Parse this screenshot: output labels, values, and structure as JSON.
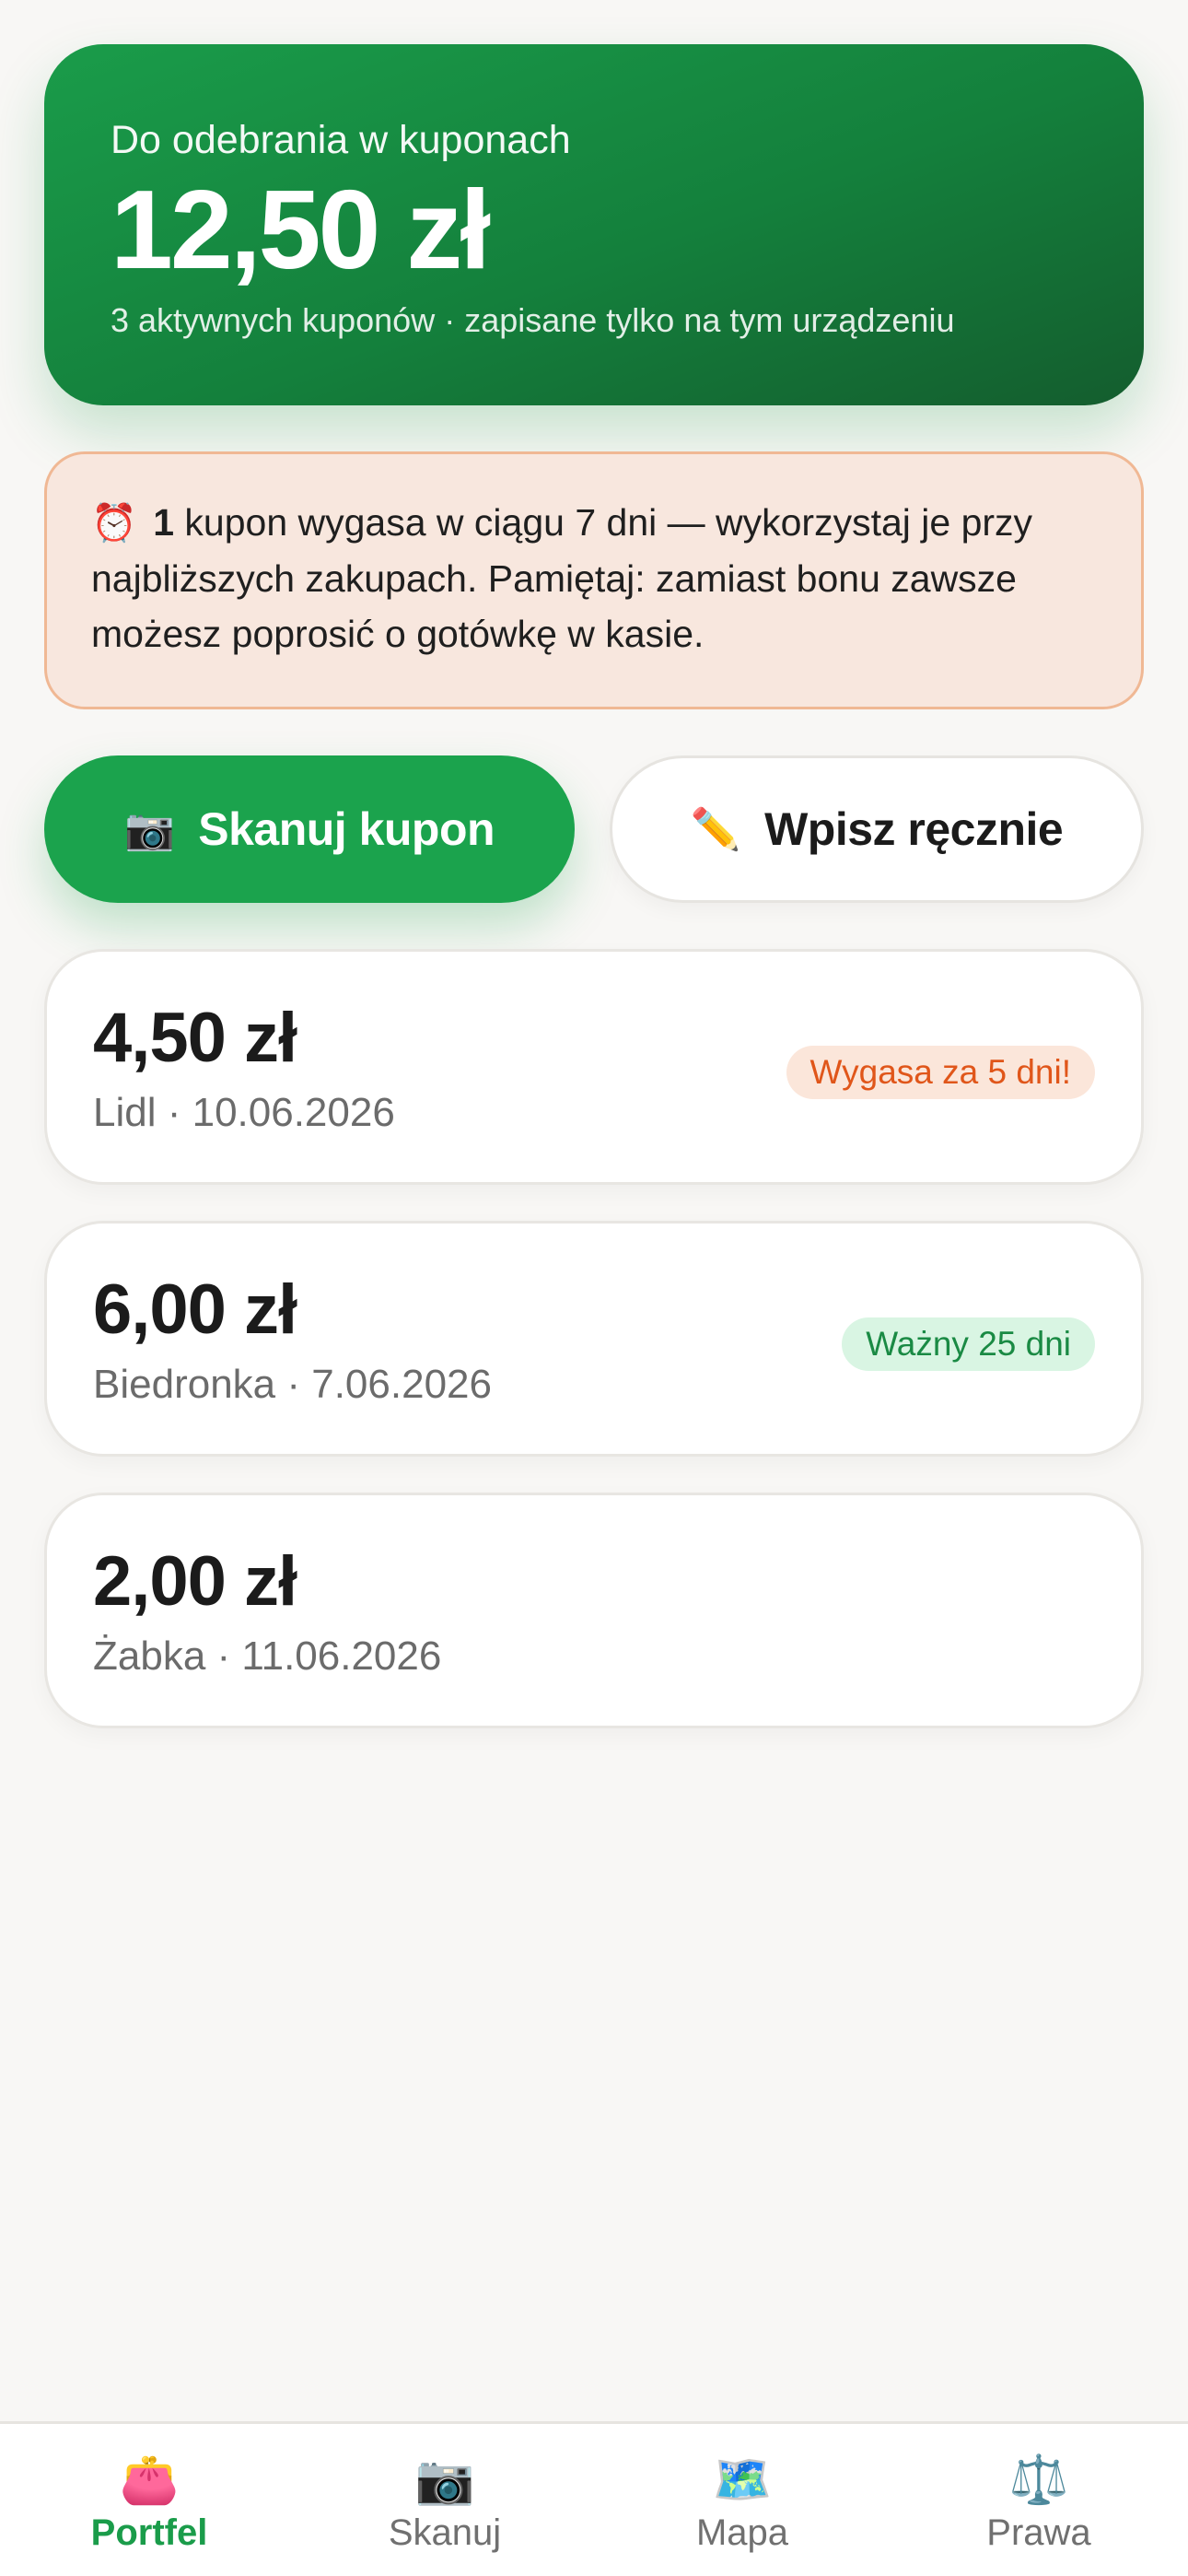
{
  "summary": {
    "label": "Do odebrania w kuponach",
    "amount": "12,50 zł",
    "subtitle": "3 aktywnych kuponów · zapisane tylko na tym urządzeniu"
  },
  "alert": {
    "icon": "⏰",
    "count": "1",
    "text": " kupon wygasa w ciągu 7 dni — wykorzystaj je przy najbliższych zakupach. Pamiętaj: zamiast bonu zawsze możesz poprosić o gotówkę w kasie."
  },
  "actions": {
    "scan": {
      "icon": "📷",
      "label": "Skanuj kupon"
    },
    "manual": {
      "icon": "✏️",
      "label": "Wpisz ręcznie"
    }
  },
  "coupons": [
    {
      "amount": "4,50 zł",
      "meta": "Lidl · 10.06.2026",
      "badge": "Wygasa za 5 dni!"
    },
    {
      "amount": "6,00 zł",
      "meta": "Biedronka · 7.06.2026",
      "badge": "Ważny 25 dni"
    },
    {
      "amount": "2,00 zł",
      "meta": "Żabka · 11.06.2026"
    }
  ],
  "tabs": [
    {
      "icon": "👛",
      "label": "Portfel"
    },
    {
      "icon": "📷",
      "label": "Skanuj"
    },
    {
      "icon": "🗺️",
      "label": "Mapa"
    },
    {
      "icon": "⚖️",
      "label": "Prawa"
    }
  ],
  "colors": {
    "brand": "#1a9c4a",
    "warning": "#e0561a",
    "success": "#1a8a44"
  }
}
